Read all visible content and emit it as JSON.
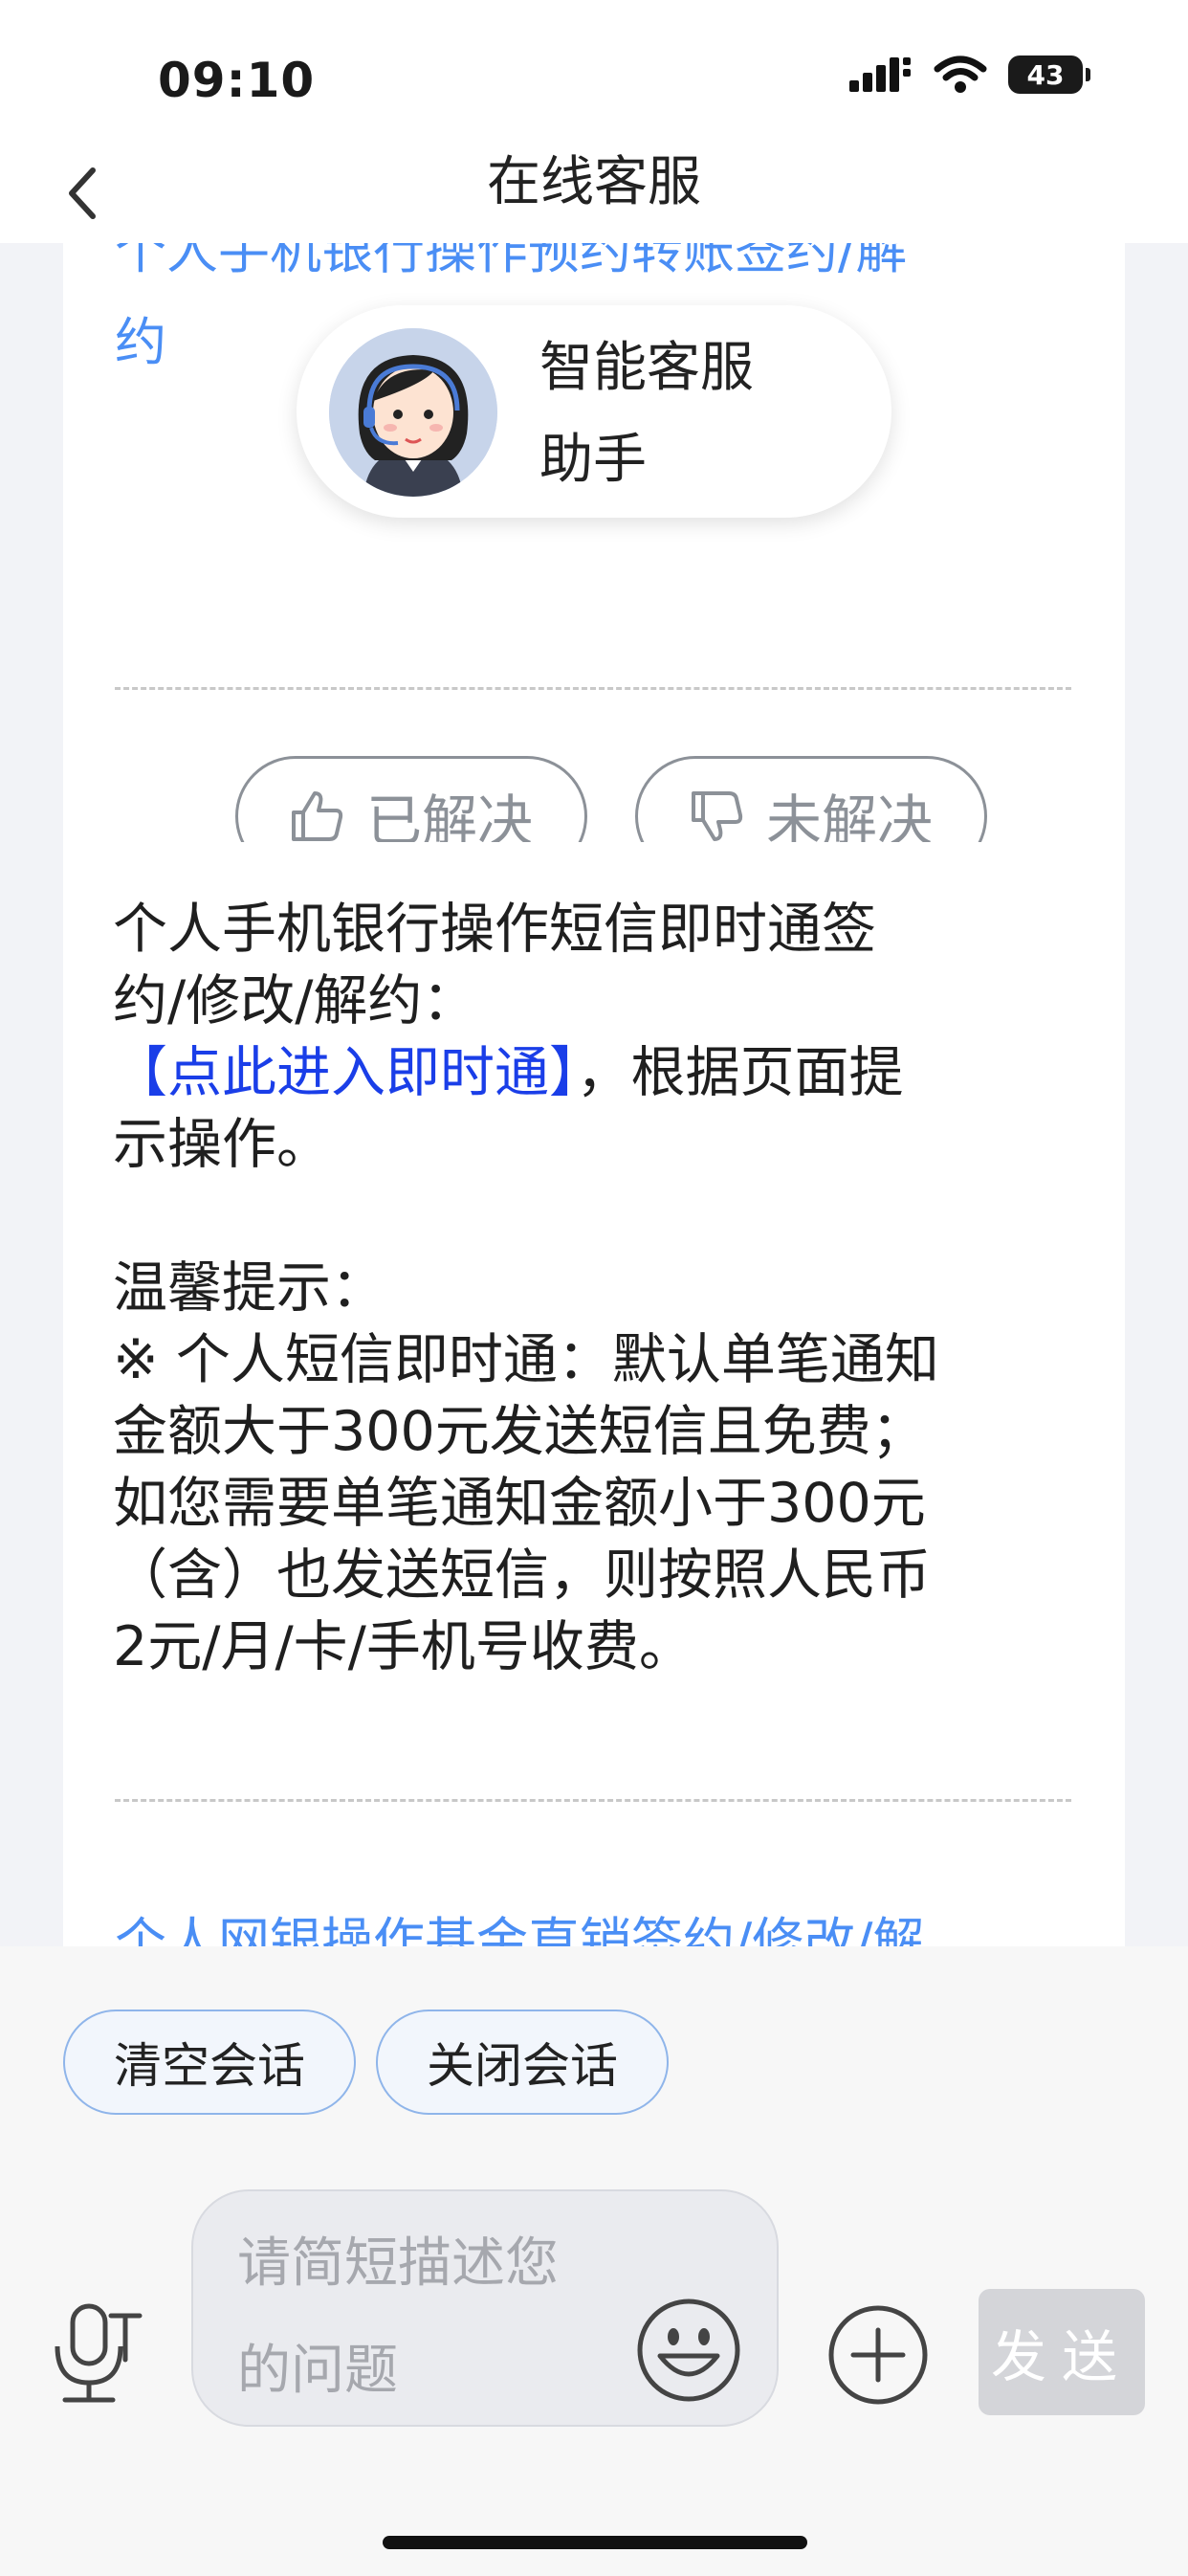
{
  "status_bar": {
    "time": "09:10",
    "battery": "43"
  },
  "nav": {
    "title": "在线客服"
  },
  "card1": {
    "link_line1": "个人手机银行操作预约转账签约/解",
    "link_line2": "约",
    "feedback": {
      "solved": "已解决",
      "unsolved": "未解决"
    }
  },
  "assistant": {
    "name_line1": "智能客服",
    "name_line2": "助手"
  },
  "card2": {
    "p1_line1": "个人手机银行操作短信即时通签",
    "p1_line2": "约/修改/解约：",
    "p1_link": "【点此进入即时通】",
    "p1_tail": "，根据页面提",
    "p1_line4": "示操作。",
    "tip_title": "温馨提示：",
    "tip_line1": "※ 个人短信即时通：默认单笔通知",
    "tip_line2": "金额大于300元发送短信且免费；",
    "tip_line3": "如您需要单笔通知金额小于300元",
    "tip_line4": "（含）也发送短信，则按照人民币",
    "tip_line5": "2元/月/卡/手机号收费。",
    "link_next": "个人网银操作基金直销签约/修改/解"
  },
  "bottom": {
    "clear_chat": "清空会话",
    "close_chat": "关闭会话",
    "input_placeholder_line1": "请简短描述您",
    "input_placeholder_line2": "的问题",
    "send": "发送"
  },
  "icons": [
    "signal-icon",
    "wifi-icon",
    "battery-icon",
    "back-arrow-icon",
    "thumbs-up-icon",
    "thumbs-down-icon",
    "voice-mic-icon",
    "emoji-icon",
    "plus-icon"
  ]
}
